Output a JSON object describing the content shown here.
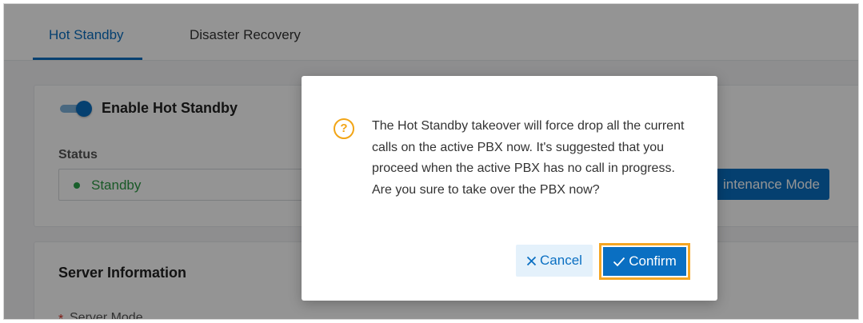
{
  "tabs": [
    {
      "label": "Hot Standby",
      "active": true
    },
    {
      "label": "Disaster Recovery",
      "active": false
    }
  ],
  "hot_standby": {
    "toggle_label": "Enable Hot Standby",
    "toggle_on": true,
    "status_label": "Status",
    "status_value": "Standby",
    "maintenance_button_label": "intenance Mode"
  },
  "server_info": {
    "title": "Server Information",
    "server_mode_label": "Server Mode"
  },
  "dialog": {
    "icon": "question-circle-icon",
    "message": "The Hot Standby takeover will force drop all the current calls on the active PBX now. It's suggested that you proceed when the active PBX has no call in progress. Are you sure to take over the PBX now?",
    "cancel_label": "Cancel",
    "confirm_label": "Confirm"
  },
  "colors": {
    "accent": "#0a6fc2",
    "status_green": "#2b9a44",
    "warning": "#f2a516",
    "highlight": "#f5a623"
  }
}
